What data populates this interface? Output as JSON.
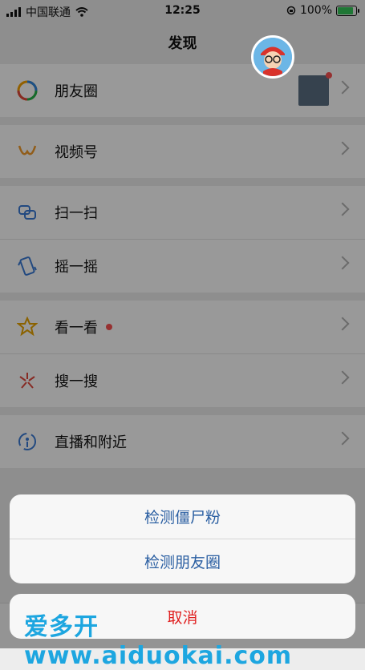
{
  "status_bar": {
    "carrier": "中国联通",
    "time": "12:25",
    "battery": "100%",
    "battery_level": 1.0
  },
  "nav": {
    "title": "发现"
  },
  "list": {
    "moments": "朋友圈",
    "channels": "视频号",
    "scan": "扫一扫",
    "shake": "摇一摇",
    "top_stories": "看一看",
    "search": "搜一搜",
    "live_nearby": "直播和附近"
  },
  "action_sheet": {
    "option_1": "检测僵尸粉",
    "option_2": "检测朋友圈",
    "cancel": "取消"
  },
  "watermark": "爱多开www.aiduokai.com",
  "colors": {
    "sheet_text": "#2b5fa2",
    "cancel_text": "#e02020",
    "badge": "#fa5151",
    "watermark": "#1da6e0"
  }
}
